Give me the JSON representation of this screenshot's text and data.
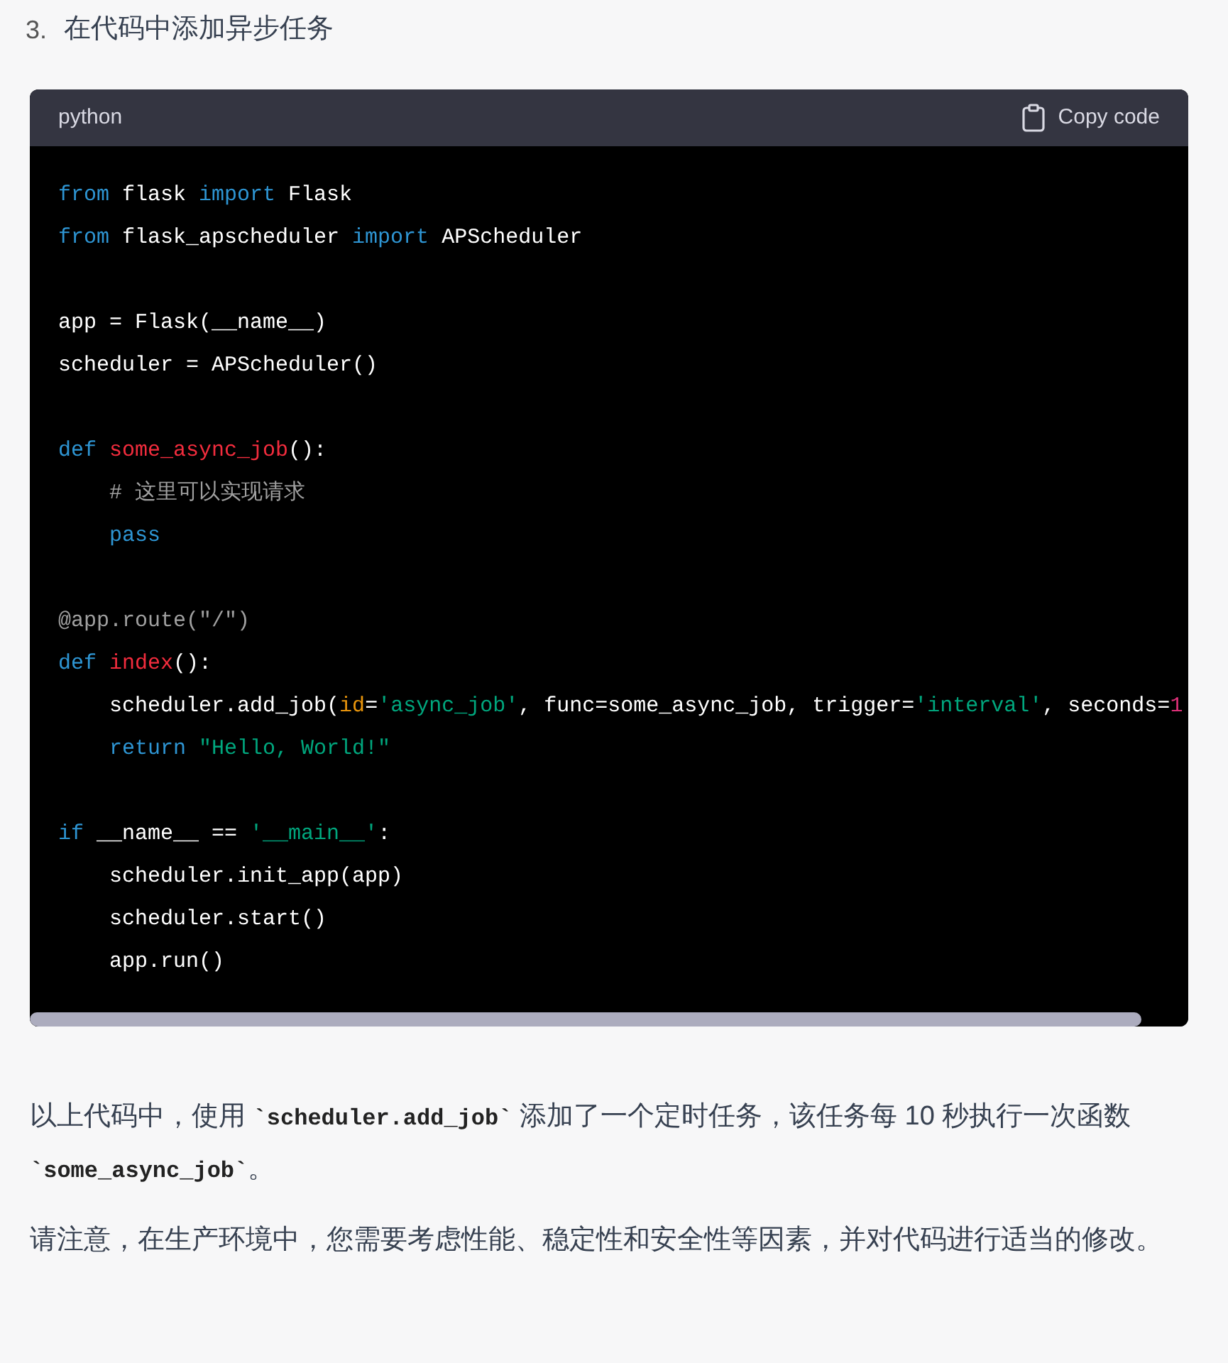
{
  "step": {
    "number": "3.",
    "title": "在代码中添加异步任务"
  },
  "code_block": {
    "language": "python",
    "copy_label": "Copy code",
    "lines": [
      {
        "kind": "code",
        "tokens": [
          {
            "text": "from",
            "kind": "keyword"
          },
          {
            "text": " flask ",
            "kind": "plain"
          },
          {
            "text": "import",
            "kind": "keyword"
          },
          {
            "text": " Flask",
            "kind": "plain"
          }
        ]
      },
      {
        "kind": "code",
        "tokens": [
          {
            "text": "from",
            "kind": "keyword"
          },
          {
            "text": " flask_apscheduler ",
            "kind": "plain"
          },
          {
            "text": "import",
            "kind": "keyword"
          },
          {
            "text": " APScheduler",
            "kind": "plain"
          }
        ]
      },
      {
        "kind": "blank"
      },
      {
        "kind": "code",
        "tokens": [
          {
            "text": "app = Flask(__name__)",
            "kind": "plain"
          }
        ]
      },
      {
        "kind": "code",
        "tokens": [
          {
            "text": "scheduler = APScheduler()",
            "kind": "plain"
          }
        ]
      },
      {
        "kind": "blank"
      },
      {
        "kind": "code",
        "tokens": [
          {
            "text": "def ",
            "kind": "keyword"
          },
          {
            "text": "some_async_job",
            "kind": "function"
          },
          {
            "text": "():",
            "kind": "plain"
          }
        ]
      },
      {
        "kind": "code",
        "tokens": [
          {
            "text": "    # 这里可以实现请求",
            "kind": "comment"
          }
        ]
      },
      {
        "kind": "code",
        "tokens": [
          {
            "text": "    pass",
            "kind": "keyword"
          }
        ]
      },
      {
        "kind": "blank"
      },
      {
        "kind": "code",
        "tokens": [
          {
            "text": "@app.route(\"/\")",
            "kind": "comment"
          }
        ]
      },
      {
        "kind": "code",
        "tokens": [
          {
            "text": "def ",
            "kind": "keyword"
          },
          {
            "text": "index",
            "kind": "function"
          },
          {
            "text": "():",
            "kind": "plain"
          }
        ]
      },
      {
        "kind": "code",
        "tokens": [
          {
            "text": "    scheduler.add_job(",
            "kind": "plain"
          },
          {
            "text": "id",
            "kind": "param"
          },
          {
            "text": "=",
            "kind": "plain"
          },
          {
            "text": "'async_job'",
            "kind": "string"
          },
          {
            "text": ", func=some_async_job, trigger=",
            "kind": "plain"
          },
          {
            "text": "'interval'",
            "kind": "string"
          },
          {
            "text": ", seconds=",
            "kind": "plain"
          },
          {
            "text": "1",
            "kind": "number"
          }
        ]
      },
      {
        "kind": "code",
        "tokens": [
          {
            "text": "    return ",
            "kind": "keyword"
          },
          {
            "text": "\"Hello, World!\"",
            "kind": "string"
          }
        ]
      },
      {
        "kind": "blank"
      },
      {
        "kind": "code",
        "tokens": [
          {
            "text": "if",
            "kind": "keyword"
          },
          {
            "text": " __name__ == ",
            "kind": "plain"
          },
          {
            "text": "'__main__'",
            "kind": "string"
          },
          {
            "text": ":",
            "kind": "plain"
          }
        ]
      },
      {
        "kind": "code",
        "tokens": [
          {
            "text": "    scheduler.init_app(app)",
            "kind": "plain"
          }
        ]
      },
      {
        "kind": "code",
        "tokens": [
          {
            "text": "    scheduler.start()",
            "kind": "plain"
          }
        ]
      },
      {
        "kind": "code",
        "tokens": [
          {
            "text": "    app.run()",
            "kind": "plain"
          }
        ]
      }
    ]
  },
  "paragraphs": [
    [
      {
        "text": "以上代码中，使用 ",
        "kind": "text"
      },
      {
        "text": "`scheduler.add_job`",
        "kind": "code"
      },
      {
        "text": " 添加了一个定时任务，该任务每 10 秒执行一次函数 ",
        "kind": "text"
      },
      {
        "text": "`some_async_job`",
        "kind": "code"
      },
      {
        "text": "。",
        "kind": "text"
      }
    ],
    [
      {
        "text": "请注意，在生产环境中，您需要考虑性能、稳定性和安全性等因素，并对代码进行适当的修改。",
        "kind": "text"
      }
    ]
  ]
}
